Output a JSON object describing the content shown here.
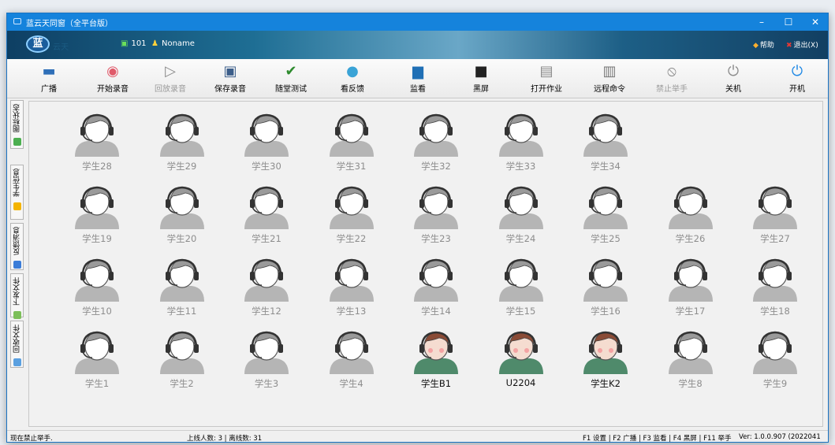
{
  "window": {
    "title": "蓝云天同窗（全平台版）",
    "controls": [
      "–",
      "☐",
      "✕"
    ]
  },
  "banner": {
    "logo_text": "蓝",
    "logo_sub": "云天",
    "room": "101",
    "user": "Noname",
    "help": "帮助",
    "exit": "退出(X)"
  },
  "toolbar": [
    {
      "label": "广播",
      "icon": "broadcast-icon",
      "enabled": true
    },
    {
      "label": "开始录音",
      "icon": "record-icon",
      "enabled": true
    },
    {
      "label": "回放录音",
      "icon": "play-icon",
      "enabled": false
    },
    {
      "label": "保存录音",
      "icon": "save-icon",
      "enabled": true
    },
    {
      "label": "随堂测试",
      "icon": "check-icon",
      "enabled": true
    },
    {
      "label": "看反馈",
      "icon": "feedback-icon",
      "enabled": true
    },
    {
      "label": "监看",
      "icon": "monitor-icon",
      "enabled": true
    },
    {
      "label": "黑屏",
      "icon": "lock-screen-icon",
      "enabled": true
    },
    {
      "label": "打开作业",
      "icon": "document-icon",
      "enabled": true
    },
    {
      "label": "远程命令",
      "icon": "remote-command-icon",
      "enabled": true
    },
    {
      "label": "禁止举手",
      "icon": "prohibit-icon",
      "enabled": false
    },
    {
      "label": "关机",
      "icon": "power-off-icon",
      "enabled": true
    },
    {
      "label": "开机",
      "icon": "power-on-icon",
      "enabled": true
    }
  ],
  "side_tabs": [
    {
      "label": "图标状态",
      "color": "#4caf50"
    },
    {
      "label": "学生信息",
      "color": "#f4b400"
    },
    {
      "label": "反馈消息",
      "color": "#3b7dd8"
    },
    {
      "label": "下发文件",
      "color": "#7cbf5a"
    },
    {
      "label": "回收文件",
      "color": "#5aa0e0"
    }
  ],
  "students": {
    "row1": [
      {
        "name": "学生28",
        "online": false
      },
      {
        "name": "学生29",
        "online": false
      },
      {
        "name": "学生30",
        "online": false
      },
      {
        "name": "学生31",
        "online": false
      },
      {
        "name": "学生32",
        "online": false
      },
      {
        "name": "学生33",
        "online": false
      },
      {
        "name": "学生34",
        "online": false
      }
    ],
    "row2": [
      {
        "name": "学生19",
        "online": false
      },
      {
        "name": "学生20",
        "online": false
      },
      {
        "name": "学生21",
        "online": false
      },
      {
        "name": "学生22",
        "online": false
      },
      {
        "name": "学生23",
        "online": false
      },
      {
        "name": "学生24",
        "online": false
      },
      {
        "name": "学生25",
        "online": false
      },
      {
        "name": "学生26",
        "online": false
      },
      {
        "name": "学生27",
        "online": false
      }
    ],
    "row3": [
      {
        "name": "学生10",
        "online": false
      },
      {
        "name": "学生11",
        "online": false
      },
      {
        "name": "学生12",
        "online": false
      },
      {
        "name": "学生13",
        "online": false
      },
      {
        "name": "学生14",
        "online": false
      },
      {
        "name": "学生15",
        "online": false
      },
      {
        "name": "学生16",
        "online": false
      },
      {
        "name": "学生17",
        "online": false
      },
      {
        "name": "学生18",
        "online": false
      }
    ],
    "row4": [
      {
        "name": "学生1",
        "online": false
      },
      {
        "name": "学生2",
        "online": false
      },
      {
        "name": "学生3",
        "online": false
      },
      {
        "name": "学生4",
        "online": false
      },
      {
        "name": "学生B1",
        "online": true
      },
      {
        "name": "U2204",
        "online": true
      },
      {
        "name": "学生K2",
        "online": true
      },
      {
        "name": "学生8",
        "online": false
      },
      {
        "name": "学生9",
        "online": false
      }
    ]
  },
  "status": {
    "message": "现在禁止举手.",
    "counts": "上线人数: 3 | 离线数: 31",
    "shortcuts": "F1 设置 | F2 广播 | F3 监看 | F4 黑屏 | F11 举手",
    "version": "Ver: 1.0.0.907 (2022041"
  },
  "colors": {
    "titlebar": "#1583dc",
    "offline_avatar": "#b5b5b5",
    "online_avatar_body": "#4f8a6b",
    "online_avatar_hair": "#8a4b36"
  }
}
